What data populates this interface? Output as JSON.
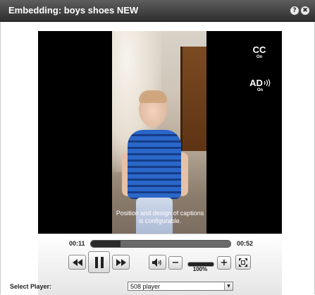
{
  "window": {
    "title": "Embedding: boys shoes NEW",
    "help_glyph": "?",
    "close_glyph": "✖"
  },
  "player": {
    "caption_line1": "Position and design of captions",
    "caption_line2": "is configurable.",
    "cc_badge": {
      "label": "CC",
      "state": "On"
    },
    "ad_badge": {
      "label": "AD",
      "state": "On"
    }
  },
  "controls": {
    "elapsed": "00:11",
    "duration": "00:52",
    "progress_fraction": 0.21,
    "volume_label": "100%",
    "volume_fraction": 1.0,
    "icons": {
      "rewind": "rewind-icon",
      "pause": "pause-icon",
      "forward": "fast-forward-icon",
      "mute": "speaker-icon",
      "volume_down": "minus-icon",
      "volume_up": "plus-icon",
      "fullscreen": "fullscreen-icon"
    },
    "glyphs": {
      "minus": "−",
      "plus": "+"
    }
  },
  "select_player": {
    "label": "Select Player:",
    "value": "508 player",
    "arrow_glyph": "▼"
  }
}
